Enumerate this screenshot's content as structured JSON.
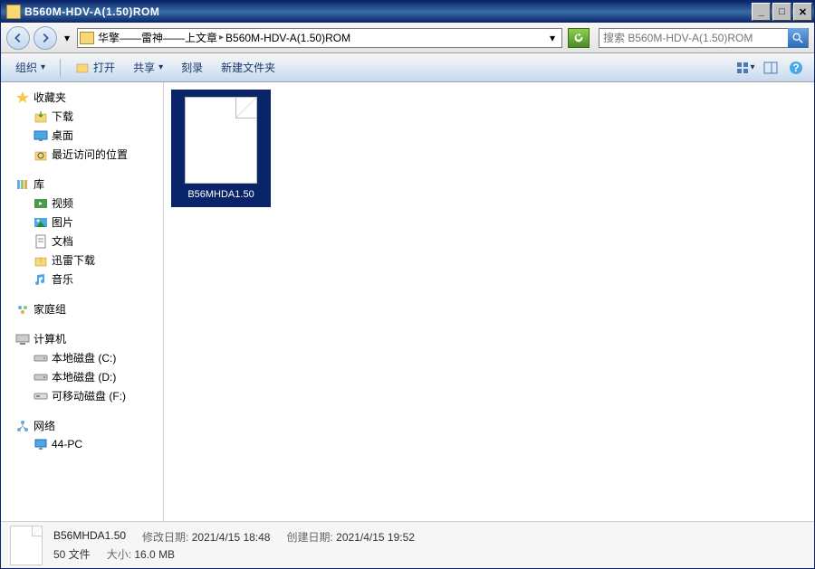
{
  "titlebar": {
    "title": "B560M-HDV-A(1.50)ROM"
  },
  "nav": {
    "breadcrumb": [
      "华擎——雷神——上文章",
      "B560M-HDV-A(1.50)ROM"
    ],
    "search_placeholder": "搜索 B560M-HDV-A(1.50)ROM"
  },
  "toolbar": {
    "organize": "组织",
    "open": "打开",
    "share": "共享",
    "burn": "刻录",
    "newfolder": "新建文件夹"
  },
  "sidebar": {
    "favorites": {
      "label": "收藏夹",
      "items": [
        "下载",
        "桌面",
        "最近访问的位置"
      ]
    },
    "libraries": {
      "label": "库",
      "items": [
        "视频",
        "图片",
        "文档",
        "迅雷下载",
        "音乐"
      ]
    },
    "homegroup": {
      "label": "家庭组"
    },
    "computer": {
      "label": "计算机",
      "items": [
        "本地磁盘 (C:)",
        "本地磁盘 (D:)",
        "可移动磁盘 (F:)"
      ]
    },
    "network": {
      "label": "网络",
      "items": [
        "44-PC"
      ]
    }
  },
  "content": {
    "files": [
      {
        "name": "B56MHDA1.50"
      }
    ]
  },
  "details": {
    "name": "B56MHDA1.50",
    "type": "50 文件",
    "modified_label": "修改日期:",
    "modified": "2021/4/15 18:48",
    "created_label": "创建日期:",
    "created": "2021/4/15 19:52",
    "size_label": "大小:",
    "size": "16.0 MB"
  }
}
